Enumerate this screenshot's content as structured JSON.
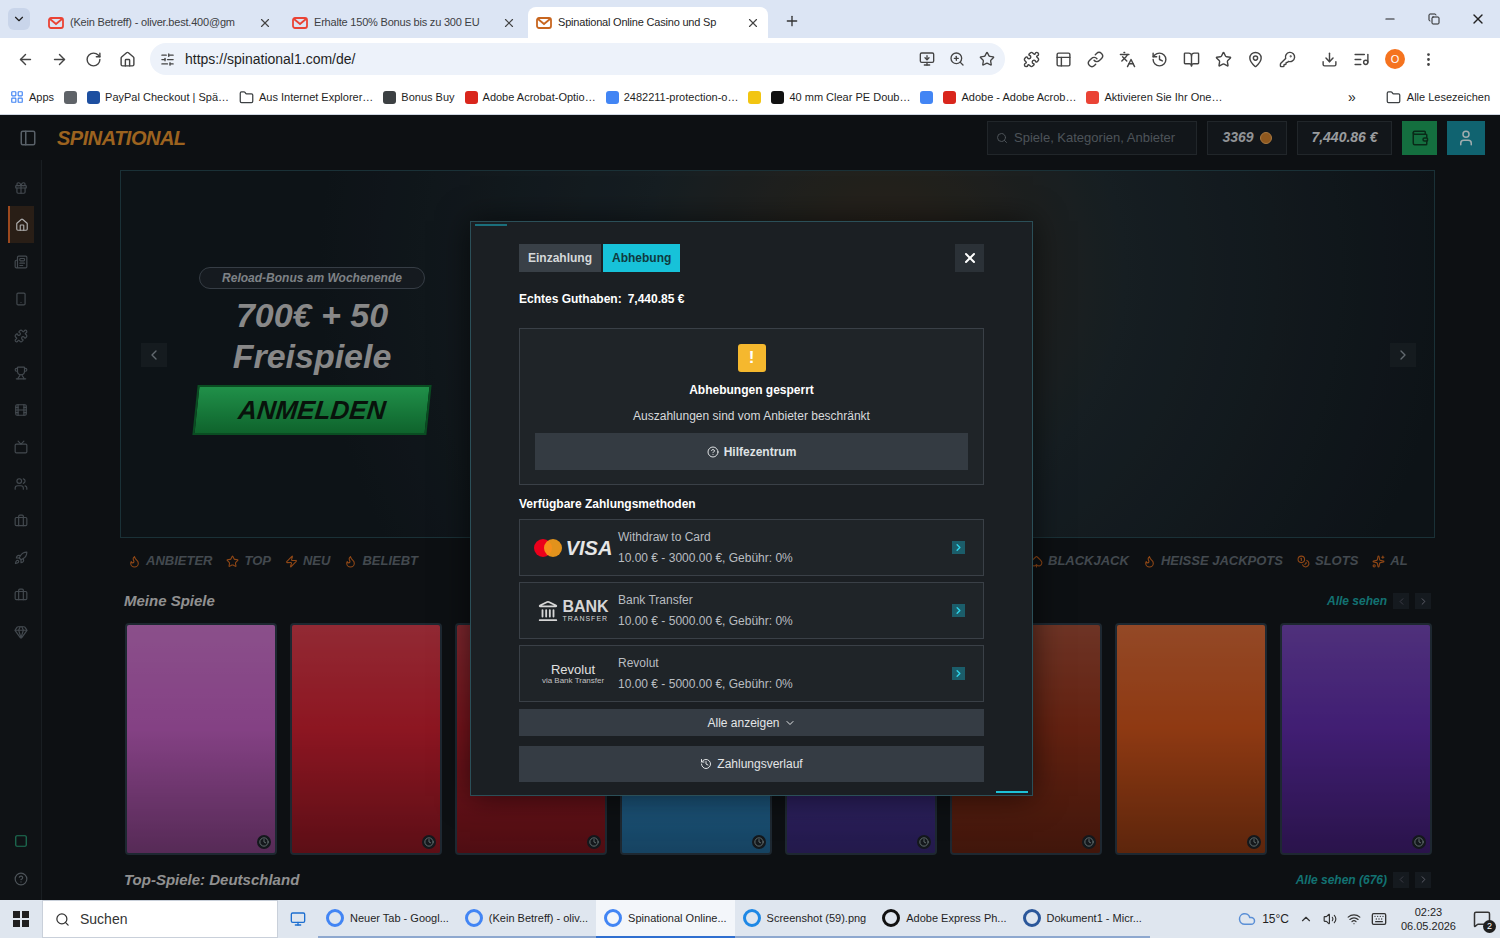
{
  "browser": {
    "tabs": [
      {
        "label": "(Kein Betreff) - oliver.best.400@gm",
        "selected": false,
        "color": "#ea4335"
      },
      {
        "label": "Erhalte 150% Bonus bis zu 300 EU",
        "selected": false,
        "color": "#ea4335"
      },
      {
        "label": "Spinational Online Casino und Sp",
        "selected": true,
        "color": "#c8661f"
      }
    ],
    "url": "https://spinational1.com/de/",
    "profile": "O",
    "bookmarks": [
      {
        "kind": "apps",
        "label": "Apps",
        "color": "#4285f4"
      },
      {
        "kind": "icon",
        "color": "#5f6368"
      },
      {
        "kind": "link",
        "label": "PayPal Checkout | Spä…",
        "color": "#1d4fa0"
      },
      {
        "kind": "folder",
        "label": "Aus Internet Explorer…",
        "color": "#3c4043"
      },
      {
        "kind": "link",
        "label": "Bonus Buy",
        "color": "#3c4043"
      },
      {
        "kind": "link",
        "label": "Adobe Acrobat-Optio…",
        "color": "#d9261c"
      },
      {
        "kind": "link",
        "label": "2482211-protection-o…",
        "color": "#4285f4"
      },
      {
        "kind": "icon",
        "color": "#f2c511"
      },
      {
        "kind": "link",
        "label": "40 mm Clear PE Doub…",
        "color": "#111111"
      },
      {
        "kind": "icon",
        "color": "#4285f4"
      },
      {
        "kind": "link",
        "label": "Adobe - Adobe Acrob…",
        "color": "#d9261c"
      },
      {
        "kind": "link",
        "label": "Aktivieren Sie Ihr One…",
        "color": "#ea4335"
      }
    ],
    "bookmarks_more": "»",
    "all_bookmarks": "Alle Lesezeichen"
  },
  "site": {
    "logo": "SPINATIONAL",
    "search": {
      "placeholder": "Spiele, Kategorien, Anbieter"
    },
    "coins": "3369",
    "balance": "7,440.86 €",
    "sidebar": {
      "items": [
        {
          "selected": false
        },
        {
          "selected": true
        },
        {
          "selected": false
        },
        {
          "selected": false
        },
        {
          "selected": false
        },
        {
          "selected": false
        },
        {
          "selected": false
        },
        {
          "selected": false
        },
        {
          "selected": false
        },
        {
          "selected": false
        },
        {
          "selected": false
        },
        {
          "selected": false
        },
        {
          "selected": false
        }
      ],
      "bottom_items": [
        {
          "selected": false
        },
        {
          "selected": false
        }
      ]
    },
    "banner": {
      "badge": "Reload-Bonus am Wochenende",
      "headline": "700€ + 50",
      "subline": "Freispiele",
      "cta": "ANMELDEN"
    },
    "categories_left": [
      "ANBIETER",
      "TOP",
      "NEU",
      "BELIEBT"
    ],
    "categories_right": [
      "BLACKJACK",
      "HEISSE JACKPOTS",
      "SLOTS",
      "AL"
    ],
    "my_games": {
      "title": "Meine Spiele",
      "see_all": "Alle sehen",
      "tiles": [
        {
          "color": "#b85bb8"
        },
        {
          "color": "#c41f2f"
        },
        {
          "color": "#a81d28"
        },
        {
          "color": "#2f8fcf"
        },
        {
          "color": "#4b37a0"
        },
        {
          "color": "#8a2f18"
        },
        {
          "color": "#c6501a"
        },
        {
          "color": "#5a2aa0"
        }
      ]
    },
    "top_games": {
      "title": "Top-Spiele: Deutschland",
      "see_all": "Alle sehen (676)",
      "tiles": [
        {
          "color": "#3a1f24"
        },
        {
          "color": "#3b2a12"
        },
        {
          "color": "#3a1a1a"
        },
        {
          "color": "#2c2550"
        },
        {
          "color": "#3a2a14"
        },
        {
          "color": "#3a1c2a"
        },
        {
          "color": "#1c1c24"
        },
        {
          "color": "#2a2a30"
        }
      ]
    }
  },
  "modal": {
    "tabs": [
      {
        "label": "Einzahlung",
        "selected": false
      },
      {
        "label": "Abhebung",
        "selected": true
      }
    ],
    "balance_label": "Echtes Guthaben:",
    "balance": "7,440.85 €",
    "warning": {
      "icon": "!",
      "title": "Abhebungen gesperrt",
      "text": "Auszahlungen sind vom Anbieter beschränkt",
      "help": "Hilfezentrum"
    },
    "methods_title": "Verfügbare Zahlungsmethoden",
    "methods": [
      {
        "kind": "card",
        "logo": "VISA",
        "name": "Withdraw to Card",
        "limits": "10.00 € - 3000.00 €, Gebühr: 0%"
      },
      {
        "kind": "bank",
        "logo": "BANK",
        "logo_sub": "TRANSFER",
        "name": "Bank Transfer",
        "limits": "10.00 € - 5000.00 €, Gebühr: 0%"
      },
      {
        "kind": "revolut",
        "logo": "Revolut",
        "logo_sub": "via Bank Transfer",
        "name": "Revolut",
        "limits": "10.00 € - 5000.00 €, Gebühr: 0%"
      }
    ],
    "show_all": "Alle anzeigen",
    "history": "Zahlungsverlauf"
  },
  "taskbar": {
    "search": "Suchen",
    "tasks": [
      {
        "label": "Neuer Tab - Googl...",
        "selected": false,
        "color": "#4285f4"
      },
      {
        "label": "(Kein Betreff) - oliv...",
        "selected": false,
        "color": "#4285f4"
      },
      {
        "label": "Spinational Online...",
        "selected": true,
        "color": "#4285f4"
      },
      {
        "label": "Screenshot (59).png",
        "selected": false,
        "color": "#1e88e5"
      },
      {
        "label": "Adobe Express Ph...",
        "selected": false,
        "color": "#111111"
      },
      {
        "label": "Dokument1 - Micr...",
        "selected": false,
        "color": "#2b579a"
      }
    ],
    "weather": "15°C",
    "time": "02:23",
    "date": "06.05.2026",
    "notifications": "2"
  }
}
